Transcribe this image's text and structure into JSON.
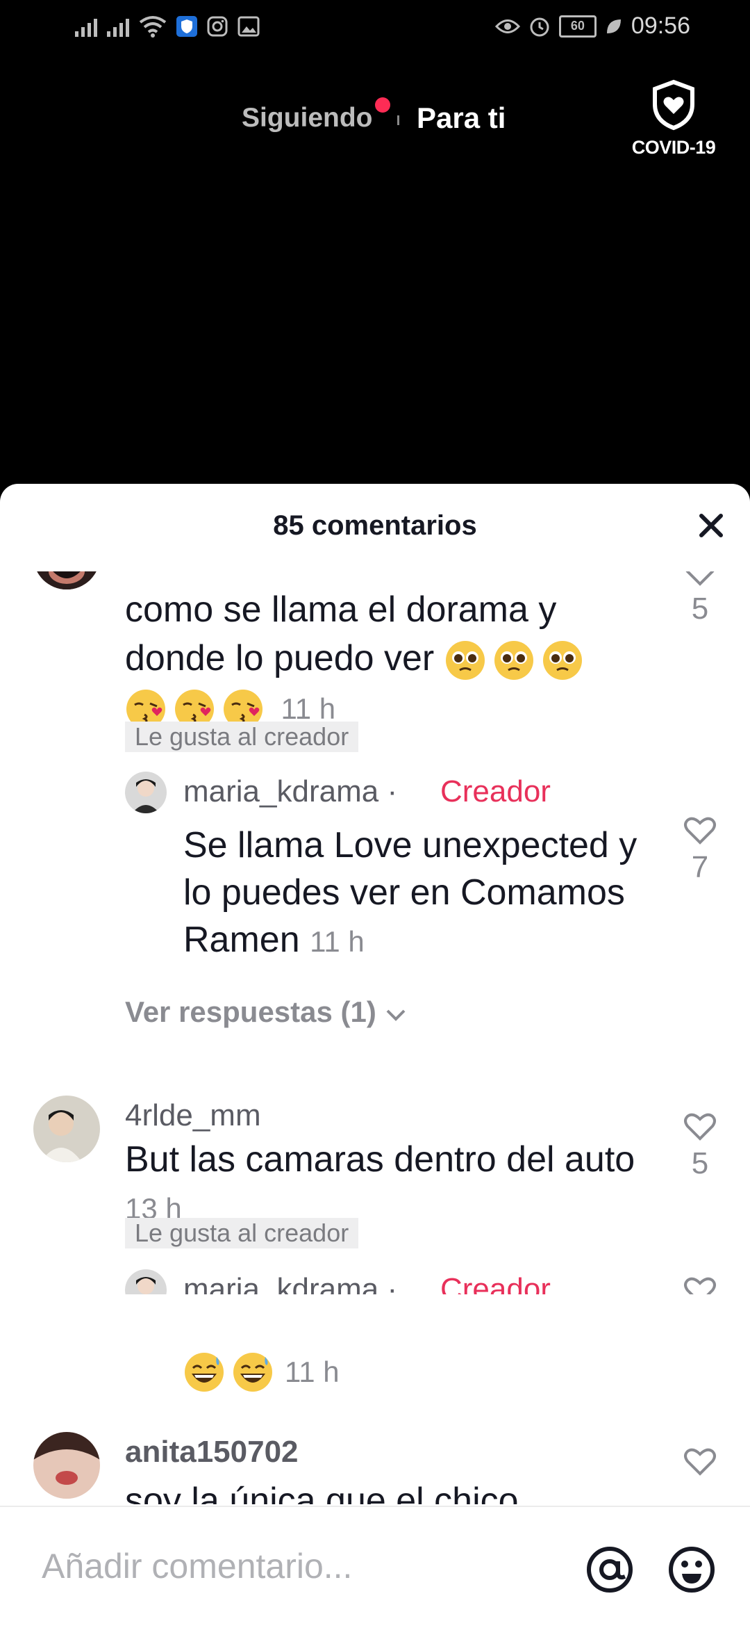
{
  "status_bar": {
    "time": "09:56",
    "battery": "60"
  },
  "top_nav": {
    "following_label": "Siguiendo",
    "for_you_label": "Para ti",
    "covid_label": "COVID-19",
    "accent_color": "#fe2c55"
  },
  "comments_sheet": {
    "title": "85 comentarios",
    "liked_by_creator_label": "Le gusta al creador",
    "creator_label": "Creador",
    "comments": [
      {
        "text": "como se llama el dorama y donde lo puedo ver",
        "time": "11 h",
        "likes": "5",
        "reply": {
          "username": "maria_kdrama",
          "text": "Se llama Love unexpected y lo puedes ver en Comamos Ramen",
          "time": "11 h",
          "likes": "7"
        },
        "view_replies": "Ver respuestas (1)"
      },
      {
        "username": "4rlde_mm",
        "text": "But las camaras dentro del auto",
        "time": "13 h",
        "likes": "5",
        "reply": {
          "username": "maria_kdrama",
          "time": "11 h"
        }
      },
      {
        "username": "anita150702",
        "text": "soy la única que el chico"
      }
    ]
  },
  "input_bar": {
    "placeholder": "Añadir comentario..."
  }
}
